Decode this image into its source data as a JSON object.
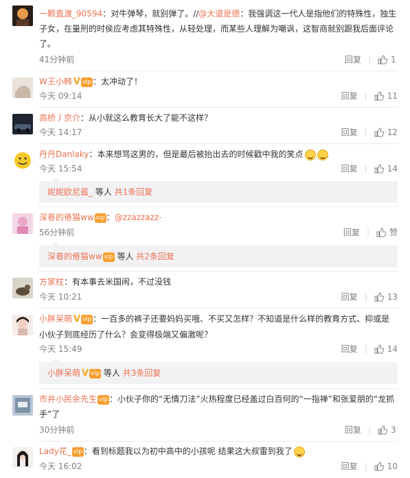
{
  "reply_label": "回复",
  "colors": {
    "username": "#eb7350",
    "meta": "#808080",
    "summary_bg": "#f2f2f5",
    "badge": "#f89e2e"
  },
  "icons": {
    "like": "thumbs-up-icon",
    "verified": "v-badge-icon",
    "vip": "vip-badge-icon",
    "emoji": "laughing-emoji-icon"
  },
  "comments": [
    {
      "user": "一颗直渡_90594",
      "mention": "@大道是德",
      "text_before": "：对牛弹琴，就别弹了。//",
      "text_after": "：我强调这一代人是指他们的特殊性，独生子女，在量刑的时侯应考虑其特殊性，从轻处理，而某些人理解为嘲讽，这智商就别跟我后面评论了。",
      "time": "41分钟前",
      "likes": "1"
    },
    {
      "user": "W王小韩",
      "text": "：太冲动了！",
      "time": "今天 09:14",
      "likes": "11"
    },
    {
      "user": "高桥丿京介",
      "text": "：从小就这么教育长大了能不这样？",
      "time": "今天 14:17",
      "likes": "12"
    },
    {
      "user": "丹丹Danlaky",
      "text": "：本来想骂这男的，但是最后被抬出去的时候戳中我的笑点",
      "time": "今天 15:54",
      "likes": "14",
      "summary": {
        "name": "妮妮欧尼酱_",
        "middle": " 等人 ",
        "total": "共1条回复"
      }
    },
    {
      "user": "深巷的倦猫ww",
      "text": "：",
      "mention": "@zzazzazz-",
      "time": "56分钟前",
      "likes": "赞",
      "summary": {
        "name": "深巷的倦猫ww",
        "middle": " 等人 ",
        "total": "共2条回复"
      }
    },
    {
      "user": "方家柱",
      "text": "：有本事去米国闹，不过没钱",
      "time": "今天 10:21",
      "likes": "13"
    },
    {
      "user": "小胖呆萌",
      "text": "：一百多的裤子还要妈妈买哦、不买又怎样？不知道是什么样的教育方式、抑或是小伙子到底经历了什么？会变得极端又偏激呢？",
      "time": "今天 15:49",
      "likes": "14",
      "summary": {
        "name": "小胖呆萌",
        "middle": " 等人 ",
        "total": "共3条回复"
      }
    },
    {
      "user": "市井小民余先生",
      "text": "：小伙子你的“无情刀法”火热程度已经盖过白百何的“一指禅”和张爱朋的“龙抓手”了",
      "time": "30分钟前",
      "likes": "3"
    },
    {
      "user": "Lady花_",
      "text": "：看到标题我以为初中高中的小孩呢 结果这大叔雷到我了",
      "time": "今天 16:02",
      "likes": "10"
    }
  ]
}
